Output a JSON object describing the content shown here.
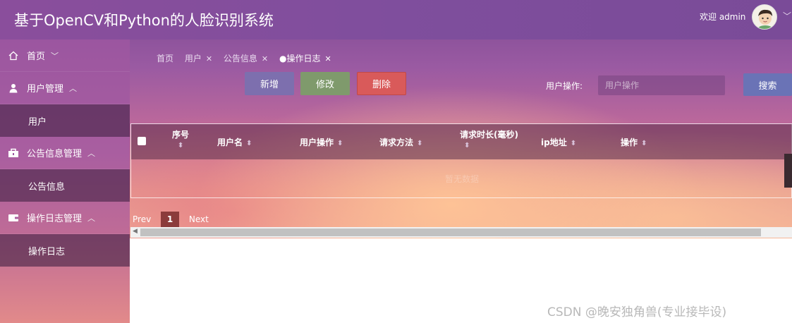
{
  "app_title": "基于OpenCV和Python的人脸识别系统",
  "user": {
    "welcome": "欢迎 admin",
    "avatar_icon": "avatar-icon"
  },
  "sidebar": {
    "items": [
      {
        "label": "首页",
        "icon": "home-icon"
      },
      {
        "label": "用户管理",
        "icon": "user-icon"
      },
      {
        "label": "用户"
      },
      {
        "label": "公告信息管理",
        "icon": "notice-icon"
      },
      {
        "label": "公告信息"
      },
      {
        "label": "操作日志管理",
        "icon": "wallet-icon"
      },
      {
        "label": "操作日志"
      }
    ]
  },
  "tabs": [
    {
      "label": "首页"
    },
    {
      "label": "用户"
    },
    {
      "label": "公告信息"
    },
    {
      "label": "●操作日志"
    }
  ],
  "toolbar": {
    "add": "新增",
    "edit": "修改",
    "delete": "删除",
    "search_label": "用户操作:",
    "search_placeholder": "用户操作",
    "search_button": "搜索"
  },
  "table": {
    "columns": [
      "序号",
      "用户名",
      "用户操作",
      "请求方法",
      "请求时长(毫秒)",
      "ip地址",
      "操作"
    ],
    "empty_text": "暂无数据"
  },
  "pager": {
    "prev": "Prev",
    "page": "1",
    "next": "Next"
  },
  "watermark": "CSDN @晚安独角兽(专业接毕设)",
  "colors": {
    "add_button": "#7d6fae",
    "edit_button": "#7f9a6c",
    "delete_button": "#d95a5a",
    "search_button": "#6a73b6",
    "page_active": "#8b3b3b"
  }
}
